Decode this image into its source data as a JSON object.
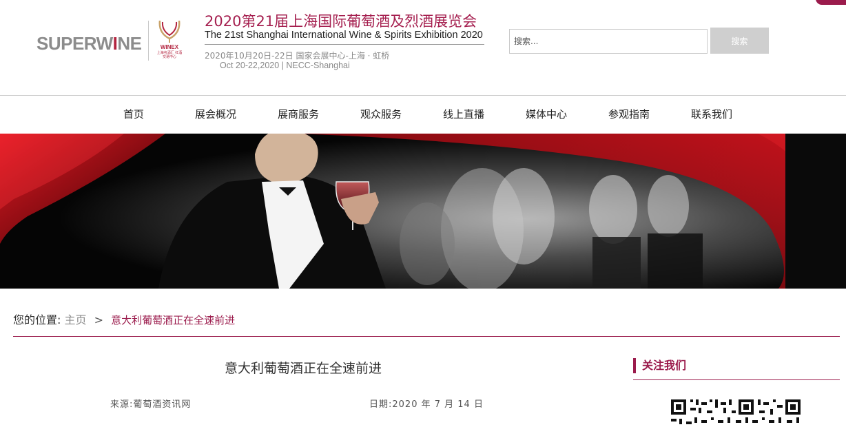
{
  "header": {
    "logo_text_grey": "SUPERW",
    "logo_text_red": "I",
    "logo_text_end": "NE",
    "winex_text": "WINEX",
    "winex_sub": "上海名酒汇 红酒交易中心",
    "title_cn": "2020第21届上海国际葡萄酒及烈酒展览会",
    "title_en": "The 21st Shanghai International Wine & Spirits Exhibition 2020",
    "date_cn": "2020年10月20日-22日  国家会展中心-上海 · 虹桥",
    "date_en": "Oct 20-22,2020 | NECC-Shanghai"
  },
  "search": {
    "placeholder": "搜索...",
    "value": "",
    "button_label": "搜索"
  },
  "nav": {
    "items": [
      {
        "label": "首页"
      },
      {
        "label": "展会概况"
      },
      {
        "label": "展商服务"
      },
      {
        "label": "观众服务"
      },
      {
        "label": "线上直播"
      },
      {
        "label": "媒体中心"
      },
      {
        "label": "参观指南"
      },
      {
        "label": "联系我们"
      }
    ]
  },
  "breadcrumb": {
    "label": "您的位置:",
    "home": "主页",
    "separator": ">",
    "current": "意大利葡萄酒正在全速前进"
  },
  "article": {
    "title": "意大利葡萄酒正在全速前进",
    "source": "来源:葡萄酒资讯网",
    "date": "日期:2020 年 7 月 14 日"
  },
  "sidebar": {
    "follow_heading": "关注我们"
  },
  "colors": {
    "accent": "#9b1b4c",
    "search_button": "#cfcfcf"
  }
}
